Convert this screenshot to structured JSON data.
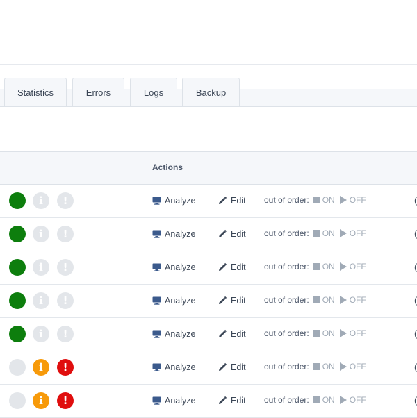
{
  "tabs": [
    {
      "label": "Statistics"
    },
    {
      "label": "Errors"
    },
    {
      "label": "Logs"
    },
    {
      "label": "Backup"
    }
  ],
  "table": {
    "header": {
      "actions": "Actions"
    },
    "rows": [
      {
        "status": "green",
        "info": "grey",
        "warning": "grey",
        "analyze": "Analyze",
        "edit": "Edit",
        "out_of_order": "out of order:",
        "on": "ON",
        "off": "OFF",
        "edge": "("
      },
      {
        "status": "green",
        "info": "grey",
        "warning": "grey",
        "analyze": "Analyze",
        "edit": "Edit",
        "out_of_order": "out of order:",
        "on": "ON",
        "off": "OFF",
        "edge": "("
      },
      {
        "status": "green",
        "info": "grey",
        "warning": "grey",
        "analyze": "Analyze",
        "edit": "Edit",
        "out_of_order": "out of order:",
        "on": "ON",
        "off": "OFF",
        "edge": "("
      },
      {
        "status": "green",
        "info": "grey",
        "warning": "grey",
        "analyze": "Analyze",
        "edit": "Edit",
        "out_of_order": "out of order:",
        "on": "ON",
        "off": "OFF",
        "edge": "("
      },
      {
        "status": "green",
        "info": "grey",
        "warning": "grey",
        "analyze": "Analyze",
        "edit": "Edit",
        "out_of_order": "out of order:",
        "on": "ON",
        "off": "OFF",
        "edge": "("
      },
      {
        "status": "grey",
        "info": "orange",
        "warning": "red",
        "analyze": "Analyze",
        "edit": "Edit",
        "out_of_order": "out of order:",
        "on": "ON",
        "off": "OFF",
        "edge": "("
      },
      {
        "status": "grey",
        "info": "orange",
        "warning": "red",
        "analyze": "Analyze",
        "edit": "Edit",
        "out_of_order": "out of order:",
        "on": "ON",
        "off": "OFF",
        "edge": "("
      }
    ]
  },
  "icons": {
    "status": "status-dot-icon",
    "info": "info-icon",
    "warning": "exclamation-icon",
    "analyze": "monitor-icon",
    "edit": "pencil-icon",
    "on": "stop-icon",
    "off": "play-icon"
  },
  "colors": {
    "green": "#0d7e0d",
    "grey": "#e3e6ea",
    "orange": "#f79a0a",
    "red": "#e00e0e",
    "muted": "#a0aab6"
  }
}
